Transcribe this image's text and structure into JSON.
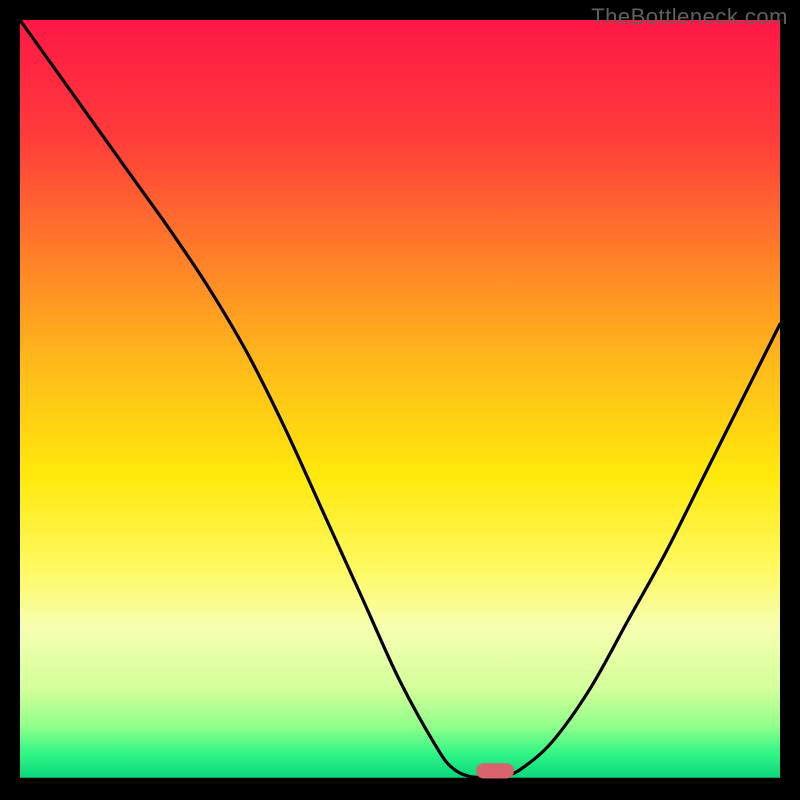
{
  "watermark": "TheBottleneck.com",
  "chart_data": {
    "type": "line",
    "title": "",
    "xlabel": "",
    "ylabel": "",
    "xlim": [
      0,
      100
    ],
    "ylim": [
      0,
      100
    ],
    "background": {
      "type": "vertical_gradient",
      "stops": [
        {
          "offset": 0.0,
          "color": "#ff1846"
        },
        {
          "offset": 0.15,
          "color": "#ff3a3a"
        },
        {
          "offset": 0.3,
          "color": "#ff7a2a"
        },
        {
          "offset": 0.45,
          "color": "#ffb91a"
        },
        {
          "offset": 0.6,
          "color": "#ffe90c"
        },
        {
          "offset": 0.72,
          "color": "#fff960"
        },
        {
          "offset": 0.8,
          "color": "#f7ffb0"
        },
        {
          "offset": 0.88,
          "color": "#d3ff9a"
        },
        {
          "offset": 0.93,
          "color": "#90ff8a"
        },
        {
          "offset": 0.965,
          "color": "#30f586"
        },
        {
          "offset": 1.0,
          "color": "#08d47a"
        }
      ]
    },
    "series": [
      {
        "name": "bottleneck-curve",
        "color": "#000000",
        "x": [
          0,
          5,
          10,
          15,
          20,
          25,
          30,
          35,
          40,
          45,
          50,
          55,
          57,
          59,
          61,
          62,
          64,
          66,
          70,
          75,
          80,
          85,
          90,
          95,
          100
        ],
        "y": [
          100,
          93,
          86,
          79,
          72,
          64.5,
          56,
          46,
          35,
          24,
          13,
          4,
          1.5,
          0.5,
          0.3,
          0.3,
          0.6,
          1.5,
          5,
          12,
          21,
          30,
          40,
          50,
          60
        ]
      }
    ],
    "marker": {
      "name": "optimum-pill",
      "x_start": 60,
      "x_end": 65,
      "y": 0.2,
      "height": 2.0,
      "color": "#d9646f"
    }
  }
}
